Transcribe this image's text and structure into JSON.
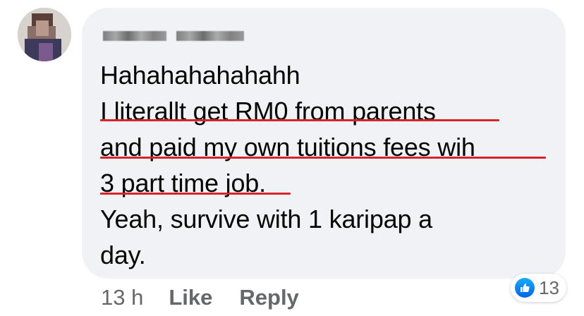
{
  "comment": {
    "author_name": "",
    "lines": [
      "Hahahahahahahh",
      "I literallt get RM0 from parents",
      "and paid my own tuitions fees wih",
      "3 part time job.",
      "Yeah, survive with 1 karipap a",
      "day."
    ],
    "underlined_lines": [
      1,
      2,
      3
    ],
    "underline_color": "#d9232b"
  },
  "meta": {
    "time": "13 h",
    "like_label": "Like",
    "reply_label": "Reply"
  },
  "reactions": {
    "icon": "thumbs-up-icon",
    "count": "13",
    "color": "#1877f2"
  },
  "colors": {
    "bubble": "#f0f2f5",
    "text": "#050505",
    "meta": "#65676b"
  }
}
